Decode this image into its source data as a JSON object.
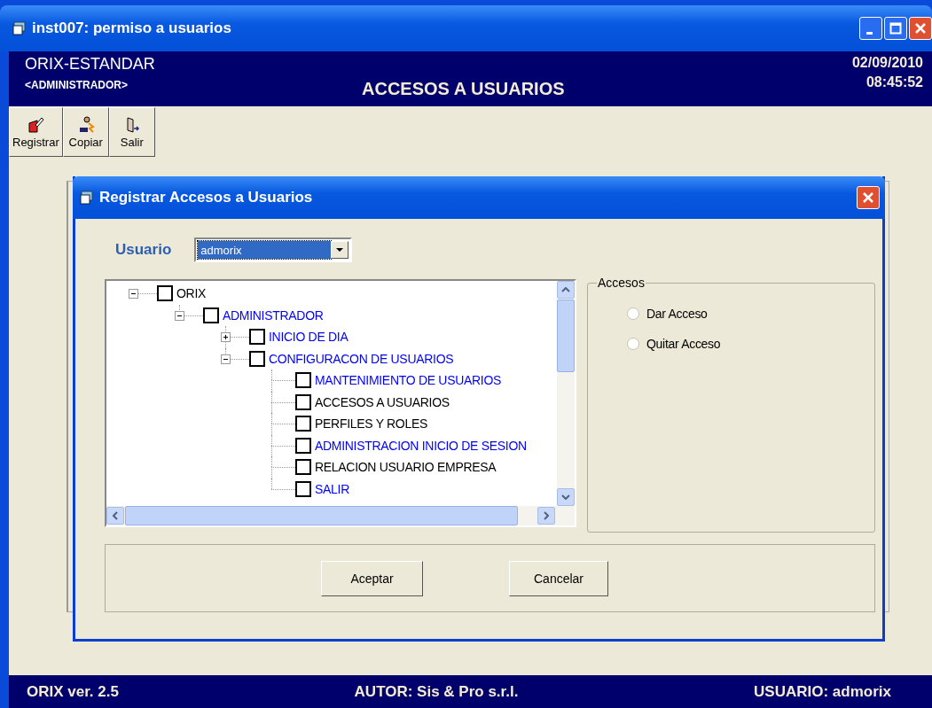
{
  "window": {
    "title": "inst007: permiso a usuarios"
  },
  "header": {
    "app": "ORIX-ESTANDAR",
    "role": "<ADMINISTRADOR>",
    "title": "ACCESOS A USUARIOS",
    "date": "02/09/2010",
    "time": "08:45:52"
  },
  "toolbar": [
    {
      "label": "Registrar",
      "kind": "register"
    },
    {
      "label": "Copiar",
      "kind": "copy"
    },
    {
      "label": "Salir",
      "kind": "exit"
    }
  ],
  "dialog": {
    "title": "Registrar Accesos a Usuarios",
    "user_label": "Usuario",
    "user": {
      "value": "admorix",
      "highlighted": true
    },
    "tree": [
      {
        "label": "ORIX",
        "color": "#000000",
        "checked": false,
        "expanded": true,
        "children": [
          {
            "label": "ADMINISTRADOR",
            "color": "#0000ff",
            "checked": false,
            "expanded": true,
            "children": [
              {
                "label": "INICIO DE DIA",
                "color": "#0000ff",
                "checked": false,
                "expanded": false
              },
              {
                "label": "CONFIGURACON DE USUARIOS",
                "color": "#0000ff",
                "checked": false,
                "expanded": true,
                "children": [
                  {
                    "label": "MANTENIMIENTO DE USUARIOS",
                    "color": "#0000ff",
                    "checked": false
                  },
                  {
                    "label": "ACCESOS A USUARIOS",
                    "color": "#000000",
                    "checked": false
                  },
                  {
                    "label": "PERFILES Y ROLES",
                    "color": "#000000",
                    "checked": false
                  },
                  {
                    "label": "ADMINISTRACION INICIO DE SESION",
                    "color": "#0000ff",
                    "checked": false
                  },
                  {
                    "label": "RELACION USUARIO EMPRESA",
                    "color": "#000000",
                    "checked": false
                  },
                  {
                    "label": "SALIR",
                    "color": "#0000ff",
                    "checked": false
                  }
                ]
              }
            ]
          }
        ]
      }
    ],
    "access_group": {
      "title": "Accesos",
      "options": [
        {
          "label": "Dar Acceso",
          "selected": false
        },
        {
          "label": "Quitar Acceso",
          "selected": false
        }
      ]
    },
    "buttons": [
      "Aceptar",
      "Cancelar"
    ]
  },
  "status_bar": {
    "version": "ORIX ver. 2.5",
    "author": "AUTOR: Sis & Pro s.r.l.",
    "user": "USUARIO: admorix"
  }
}
